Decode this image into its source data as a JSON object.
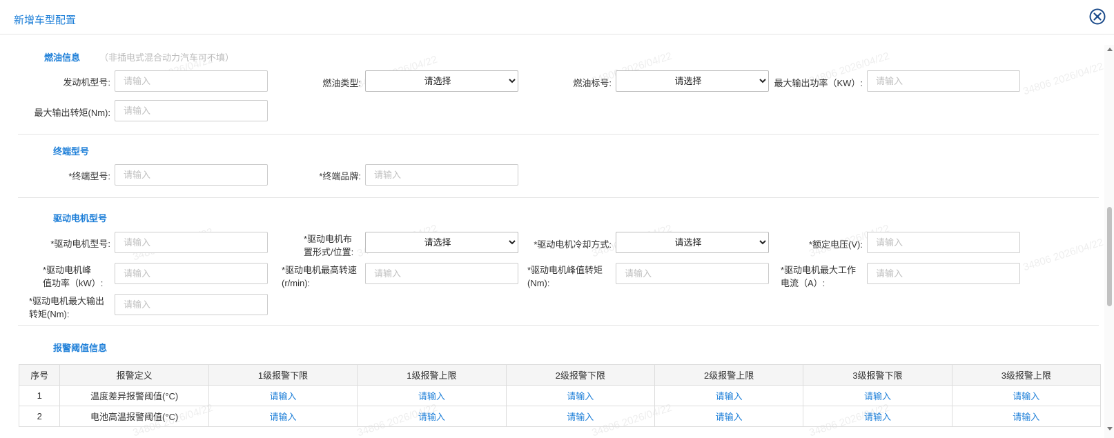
{
  "dialog": {
    "title": "新增车型配置",
    "close_icon": "close-circle-icon",
    "accent_color": "#1e7fd8"
  },
  "watermark": "34806 2026/04/22",
  "fuel": {
    "title": "燃油信息",
    "note": "（非插电式混合动力汽车可不填）",
    "engine_model_label": "发动机型号:",
    "engine_model_placeholder": "请输入",
    "fuel_type_label": "燃油类型:",
    "fuel_type_value": "请选择",
    "fuel_grade_label": "燃油标号:",
    "fuel_grade_value": "请选择",
    "max_power_label": "最大输出功率（KW）:",
    "max_power_placeholder": "请输入",
    "max_torque_label": "最大输出转矩(Nm):",
    "max_torque_placeholder": "请输入"
  },
  "terminal": {
    "title": "终端型号",
    "model_label": "*终端型号:",
    "model_placeholder": "请输入",
    "brand_label": "*终端品牌:",
    "brand_placeholder": "请输入"
  },
  "motor": {
    "title": "驱动电机型号",
    "model_label": "*驱动电机型号:",
    "model_placeholder": "请输入",
    "layout_label_1": "*驱动电机布",
    "layout_label_2": "置形式/位置:",
    "layout_value": "请选择",
    "cooling_label": "*驱动电机冷却方式:",
    "cooling_value": "请选择",
    "rated_voltage_label": "*额定电压(V):",
    "rated_voltage_placeholder": "请输入",
    "peak_power_label_1": "*驱动电机峰",
    "peak_power_label_2": "值功率（kW）:",
    "peak_power_placeholder": "请输入",
    "max_speed_label_1": "*驱动电机最高转速",
    "max_speed_label_2": "(r/min):",
    "max_speed_placeholder": "请输入",
    "peak_torque_label_1": "*驱动电机峰值转矩",
    "peak_torque_label_2": "(Nm):",
    "peak_torque_placeholder": "请输入",
    "max_current_label_1": "*驱动电机最大工作",
    "max_current_label_2": "电流（A）:",
    "max_current_placeholder": "请输入",
    "max_out_torque_label_1": "*驱动电机最大输出",
    "max_out_torque_label_2": "转矩(Nm):",
    "max_out_torque_placeholder": "请输入"
  },
  "alarm": {
    "title": "报警阈值信息",
    "headers": [
      "序号",
      "报警定义",
      "1级报警下限",
      "1级报警上限",
      "2级报警下限",
      "2级报警上限",
      "3级报警下限",
      "3级报警上限"
    ],
    "rows": [
      {
        "index": "1",
        "definition": "温度差异报警阈值(°C)",
        "cells": [
          "请输入",
          "请输入",
          "请输入",
          "请输入",
          "请输入",
          "请输入"
        ]
      },
      {
        "index": "2",
        "definition": "电池高温报警阈值(°C)",
        "cells": [
          "请输入",
          "请输入",
          "请输入",
          "请输入",
          "请输入",
          "请输入"
        ]
      }
    ]
  }
}
